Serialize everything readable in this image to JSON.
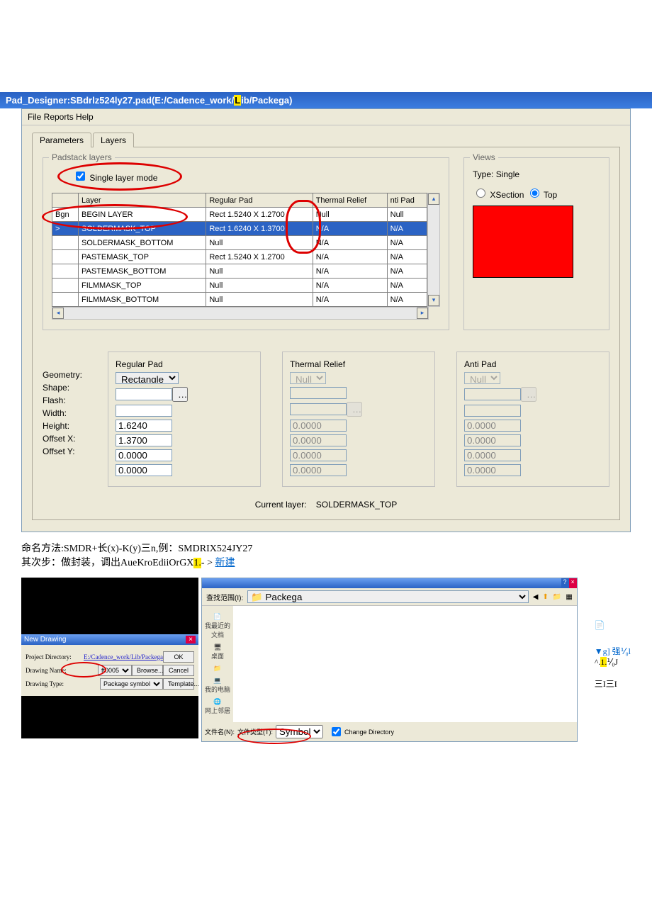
{
  "title": {
    "pre": "Pad_Designer:SBdrlz524ly27.pad(E:/Cadence_work/",
    "hl": "L",
    "post": "ib/Packega)"
  },
  "menu": "File Reports Help",
  "tabs": {
    "t1": "Parameters",
    "t2": "Layers"
  },
  "padstack": {
    "title": "Padstack layers",
    "slm": "Single layer mode",
    "hdr": {
      "c0": "",
      "c1": "Layer",
      "c2": "Regular Pad",
      "c3": "Thermal Relief",
      "c4": "nti Pad"
    },
    "rows": [
      {
        "c0": "Bgn",
        "c1": "BEGIN LAYER",
        "c2": "Rect 1.5240 X 1.2700",
        "c3": "Null",
        "c4": "Null"
      },
      {
        "c0": ">",
        "c1": "SOLDERMASK_TOP",
        "c2": "Rect 1.6240 X 1.3700",
        "c3": "N/A",
        "c4": "N/A",
        "sel": true
      },
      {
        "c0": "",
        "c1": "SOLDERMASK_BOTTOM",
        "c2": "Null",
        "c3": "N/A",
        "c4": "N/A"
      },
      {
        "c0": "",
        "c1": "PASTEMASK_TOP",
        "c2": "Rect 1.5240 X 1.2700",
        "c3": "N/A",
        "c4": "N/A"
      },
      {
        "c0": "",
        "c1": "PASTEMASK_BOTTOM",
        "c2": "Null",
        "c3": "N/A",
        "c4": "N/A"
      },
      {
        "c0": "",
        "c1": "FILMMASK_TOP",
        "c2": "Null",
        "c3": "N/A",
        "c4": "N/A"
      },
      {
        "c0": "",
        "c1": "FILMMASK_BOTTOM",
        "c2": "Null",
        "c3": "N/A",
        "c4": "N/A"
      }
    ]
  },
  "views": {
    "title": "Views",
    "typel": "Type:",
    "typev": "Single",
    "r1": "XSection",
    "r2": "Top"
  },
  "pg": {
    "reg": {
      "t": "Regular Pad",
      "geom": "Rectangle",
      "shape": "",
      "flash": "",
      "w": "1.6240",
      "h": "1.3700",
      "ox": "0.0000",
      "oy": "0.0000"
    },
    "tr": {
      "t": "Thermal Relief",
      "geom": "Null",
      "w": "0.0000",
      "h": "0.0000",
      "ox": "0.0000",
      "oy": "0.0000"
    },
    "ap": {
      "t": "Anti Pad",
      "geom": "Null",
      "w": "0.0000",
      "h": "0.0000",
      "ox": "0.0000",
      "oy": "0.0000"
    },
    "lbl": {
      "geom": "Geometry:",
      "shape": "Shape:",
      "flash": "Flash:",
      "w": "Width:",
      "h": "Height:",
      "ox": "Offset X:",
      "oy": "Offset Y:"
    }
  },
  "cur": {
    "l": "Current layer:",
    "v": "SOLDERMASK_TOP"
  },
  "doc": {
    "l1": "命名方法:SMDR+长(x)-K(y)三n,例：SMDRIX524JY27",
    "l2a": "其次步：做封装，调出AueKroEdiiOrGX",
    "l2h": "1.",
    "l2b": "- > ",
    "l2c": "新建"
  },
  "nd": {
    "t": "New Drawing",
    "pd": "Project Directory:",
    "pdv": "E:/Cadence_work/Lib/Packega",
    "dn": "Drawing Name:",
    "dnv": "ft0005",
    "dt": "Drawing Type:",
    "dtv": "Package symbol",
    "ok": "OK",
    "cancel": "Cancel",
    "br": "Browse...",
    "tpl": "Template..."
  },
  "od": {
    "look": "查找范围(I):",
    "lookv": "Packega",
    "recent": "我最近的文档",
    "desk": "桌面",
    "mydoc": "",
    "mypc": "我的电脑",
    "net": "网上邻居",
    "fn": "文件名(N):",
    "ft": "文件类型(T):",
    "ftv": "Symbol",
    "cd": "Change Directory"
  },
  "ann": {
    "a1": "▼g] 强⅟₀l",
    "a2": "^.",
    "a2h": "1.",
    "a2b": "⅟₀J",
    "a3": "三I三I"
  }
}
